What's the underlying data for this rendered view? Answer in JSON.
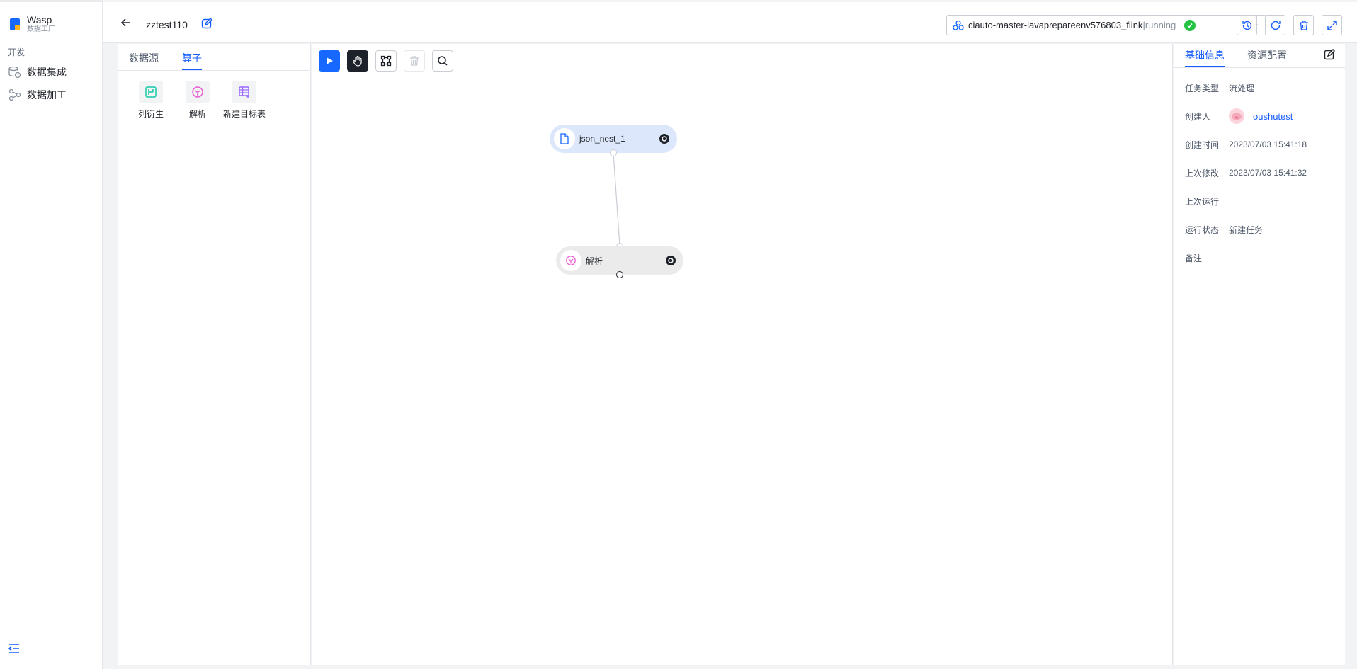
{
  "brand": {
    "name": "Wasp",
    "subtitle": "数据工厂"
  },
  "nav": {
    "section": "开发",
    "items": [
      {
        "label": "数据集成",
        "icon": "data-integration-icon"
      },
      {
        "label": "数据加工",
        "icon": "data-processing-icon"
      }
    ]
  },
  "header": {
    "task_name": "zztest110",
    "cluster": {
      "name": "ciauto-master-lavaprepareenv576803_flink",
      "separator": "|",
      "status": "running"
    }
  },
  "operator_panel": {
    "tabs": [
      {
        "label": "数据源",
        "active": false
      },
      {
        "label": "算子",
        "active": true
      }
    ],
    "operators": [
      {
        "label": "列衍生",
        "icon": "column-derive-icon",
        "color": "#14c9a8"
      },
      {
        "label": "解析",
        "icon": "parse-icon",
        "color": "#e85fd1"
      },
      {
        "label": "新建目标表",
        "icon": "new-target-table-icon",
        "color": "#9b6bff"
      }
    ]
  },
  "canvas": {
    "nodes": [
      {
        "label": "json_nest_1",
        "icon": "file-icon",
        "selected": true
      },
      {
        "label": "解析",
        "icon": "parse-icon",
        "selected": false
      }
    ]
  },
  "info_panel": {
    "tabs": [
      {
        "label": "基础信息",
        "active": true
      },
      {
        "label": "资源配置",
        "active": false
      }
    ],
    "fields": {
      "task_type": {
        "key": "任务类型",
        "value": "流处理"
      },
      "creator": {
        "key": "创建人",
        "value": "oushutest"
      },
      "created_at": {
        "key": "创建时间",
        "value": "2023/07/03 15:41:18"
      },
      "modified_at": {
        "key": "上次修改",
        "value": "2023/07/03 15:41:32"
      },
      "last_run": {
        "key": "上次运行",
        "value": ""
      },
      "run_status": {
        "key": "运行状态",
        "value": "新建任务"
      },
      "remark": {
        "key": "备注",
        "value": ""
      }
    }
  },
  "colors": {
    "accent": "#165dff",
    "running": "#23c343",
    "selected_node": "#dde7fb",
    "node": "#ebebeb"
  }
}
